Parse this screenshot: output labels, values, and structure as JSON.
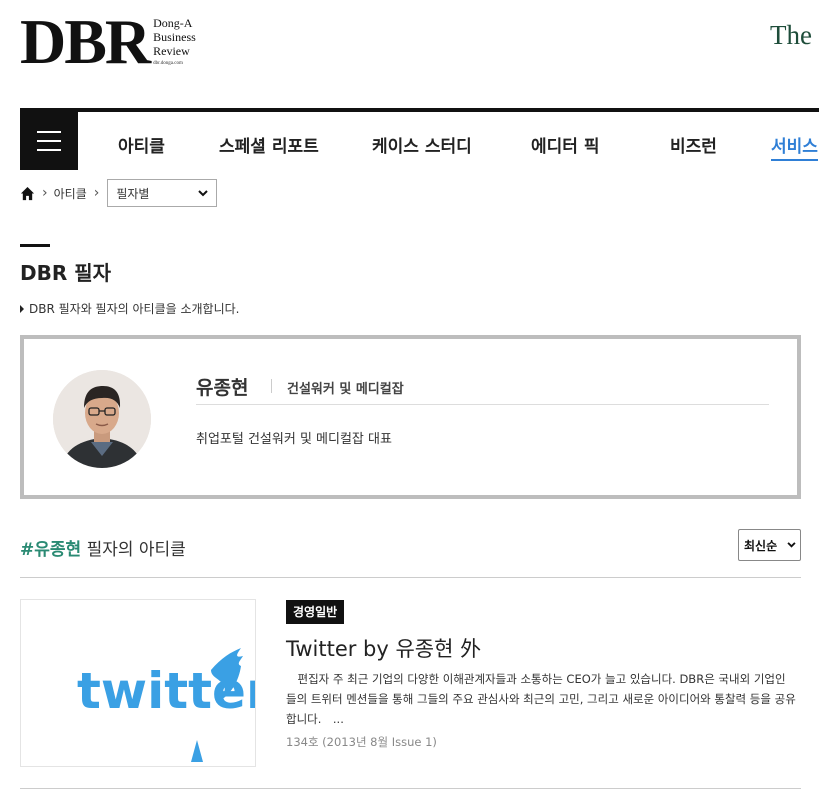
{
  "header": {
    "logo_main": "DBR",
    "logo_line1": "Dong-A",
    "logo_line2": "Business",
    "logo_line3": "Review",
    "logo_url": "dbr.donga.com",
    "right_text": "The"
  },
  "nav": {
    "items": [
      {
        "label": "아티클"
      },
      {
        "label": "스페셜 리포트"
      },
      {
        "label": "케이스 스터디"
      },
      {
        "label": "에디터 픽"
      },
      {
        "label": "비즈런"
      },
      {
        "label": "서비스"
      }
    ]
  },
  "breadcrumb": {
    "level1": "아티클",
    "select_value": "필자별"
  },
  "page": {
    "title": "DBR 필자",
    "description": "DBR 필자와 필자의 아티클을 소개합니다."
  },
  "author": {
    "name": "유종현",
    "org": "건설워커 및 메디컬잡",
    "description": "취업포털 건설워커 및 메디컬잡 대표"
  },
  "articles": {
    "tag": "#유종현",
    "heading_suffix": " 필자의 아티클",
    "sort_value": "최신순",
    "items": [
      {
        "category": "경영일반",
        "title": "Twitter by 유종현 外",
        "thumbnail_text": "twitter",
        "summary": "　편집자 주 최근 기업의 다양한 이해관계자들과 소통하는 CEO가 늘고 있습니다. DBR은 국내외 기업인들의 트위터 멘션들을 통해 그들의 주요 관심사와 최근의 고민, 그리고 새로운 아이디어와 통찰력 등을 공유합니다.　...",
        "meta": "134호 (2013년 8월 Issue 1)"
      }
    ]
  },
  "colors": {
    "accent_green": "#2a8a73",
    "accent_blue": "#2f7fd6",
    "twitter_blue": "#3aa0e4"
  }
}
